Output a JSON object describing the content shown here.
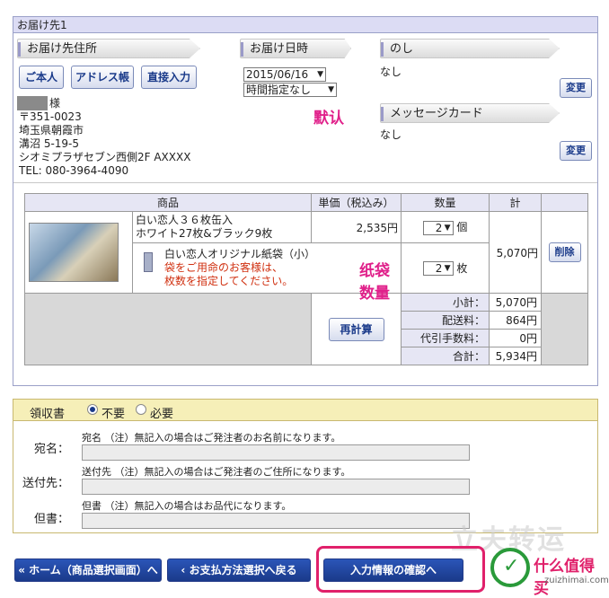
{
  "delivery": {
    "header": "お届け先1",
    "address_section": {
      "title": "お届け先住所",
      "buttons": [
        "ご本人",
        "アドレス帳",
        "直接入力"
      ],
      "name_suffix": "様",
      "lines": [
        "〒351-0023",
        "埼玉県朝霞市",
        "溝沼 5-19-5",
        "シオミプラザセブン西側2F AXXXX",
        "TEL: 080-3964-4090"
      ]
    },
    "date_section": {
      "title": "お届け日時",
      "date": "2015/06/16",
      "time": "時間指定なし"
    },
    "noshi_section": {
      "title": "のし",
      "value": "なし",
      "change_label": "変更"
    },
    "message_section": {
      "title": "メッセージカード",
      "value": "なし",
      "change_label": "変更"
    },
    "annotation_default": "默认"
  },
  "products": {
    "headers": [
      "商品",
      "単価（税込み）",
      "数量",
      "計"
    ],
    "item": {
      "name_line1": "白い恋人３６枚缶入",
      "name_line2": "ホワイト27枚&ブラック9枚",
      "price": "2,535円",
      "qty": "2",
      "qty_unit": "個",
      "total": "5,070円",
      "delete_label": "削除"
    },
    "bag": {
      "name": "白い恋人オリジナル紙袋（小）",
      "note_line1": "袋をご用命のお客様は、",
      "note_line2": "枚数を指定してください。",
      "qty": "2",
      "qty_unit": "枚"
    },
    "annotation_bag": "纸袋数量",
    "recalc_label": "再計算",
    "summary": [
      {
        "label": "小計：",
        "value": "5,070円"
      },
      {
        "label": "配送料：",
        "value": "864円"
      },
      {
        "label": "代引手数料：",
        "value": "0円"
      },
      {
        "label": "合計：",
        "value": "5,934円"
      }
    ]
  },
  "receipt": {
    "title": "領収書",
    "option_no": "不要",
    "option_yes": "必要",
    "fields": [
      {
        "label": "宛名：",
        "note": "宛名 （注）無記入の場合はご発注者のお名前になります。"
      },
      {
        "label": "送付先：",
        "note": "送付先 （注）無記入の場合はご発注者のご住所になります。"
      },
      {
        "label": "但書：",
        "note": "但書 （注）無記入の場合はお品代になります。"
      }
    ]
  },
  "nav": {
    "home_label": "ホーム（商品選択画面）へ",
    "back_label": "お支払方法選択へ戻る",
    "confirm_label": "入力情報の確認へ"
  },
  "watermark": {
    "text1": "立夫转运",
    "text2": "什么值得买",
    "text3": "zuizhimai.com"
  },
  "colors": {
    "accent_pink": "#e0208a",
    "nav_blue": "#1a3a8a",
    "header_lavender": "#dcdcf4",
    "receipt_yellow": "#f6efb8"
  }
}
